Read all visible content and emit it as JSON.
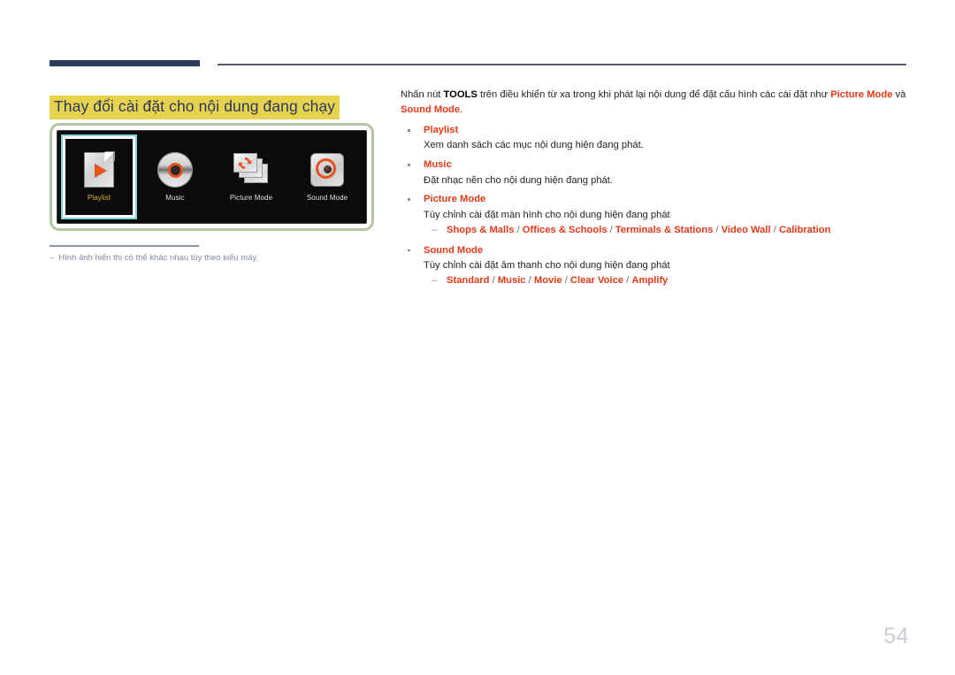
{
  "header": {
    "rule_color_thick": "#2b3a5c",
    "rule_color_thin": "#5a5a73"
  },
  "title": {
    "text": "Thay đổi cài đặt cho nội dung đang chạy",
    "highlight_color": "#e6d24e",
    "text_color": "#2b3a5c"
  },
  "illustration": {
    "frame_color": "#b6c5a1",
    "screen_bg": "#0b0b0b",
    "selected_border_color": "#7fd4d8",
    "accent_color": "#e8521f",
    "selected_label_color": "#e0b22a",
    "menu_items": [
      {
        "label": "Playlist",
        "icon": "playlist-page-play-icon",
        "selected": true
      },
      {
        "label": "Music",
        "icon": "music-cd-disc-icon",
        "selected": false
      },
      {
        "label": "Picture Mode",
        "icon": "picture-mode-panels-refresh-icon",
        "selected": false
      },
      {
        "label": "Sound Mode",
        "icon": "sound-mode-speaker-icon",
        "selected": false
      }
    ]
  },
  "footnote": {
    "dash": "‒",
    "text": "Hình ảnh hiển thị có thể khác nhau tùy theo kiểu máy.",
    "color": "#8189a3"
  },
  "body": {
    "intro": {
      "part1": "Nhấn nút ",
      "tools": "TOOLS",
      "part2": " trên điều khiển từ xa trong khi phát lại nội dung để đặt cấu hình các cài đặt như ",
      "picture_mode": "Picture Mode",
      "part3": " và ",
      "sound_mode": "Sound Mode",
      "part4": "."
    },
    "items": [
      {
        "title": "Playlist",
        "desc": "Xem danh sách các mục nội dung hiện đang phát."
      },
      {
        "title": "Music",
        "desc": "Đặt nhạc nền cho nội dung hiện đang phát."
      },
      {
        "title": "Picture Mode",
        "desc": "Tùy chỉnh cài đặt màn hình cho nội dung hiện đang phát",
        "options": [
          "Shops & Malls",
          "Offices & Schools",
          "Terminals & Stations",
          "Video Wall",
          "Calibration"
        ]
      },
      {
        "title": "Sound Mode",
        "desc": "Tùy chỉnh cài đặt âm thanh cho nội dung hiện đang phát",
        "options": [
          "Standard",
          "Music",
          "Movie",
          "Clear Voice",
          "Amplify"
        ]
      }
    ],
    "separator": "/",
    "accent_color": "#e03a16"
  },
  "page_number": "54"
}
